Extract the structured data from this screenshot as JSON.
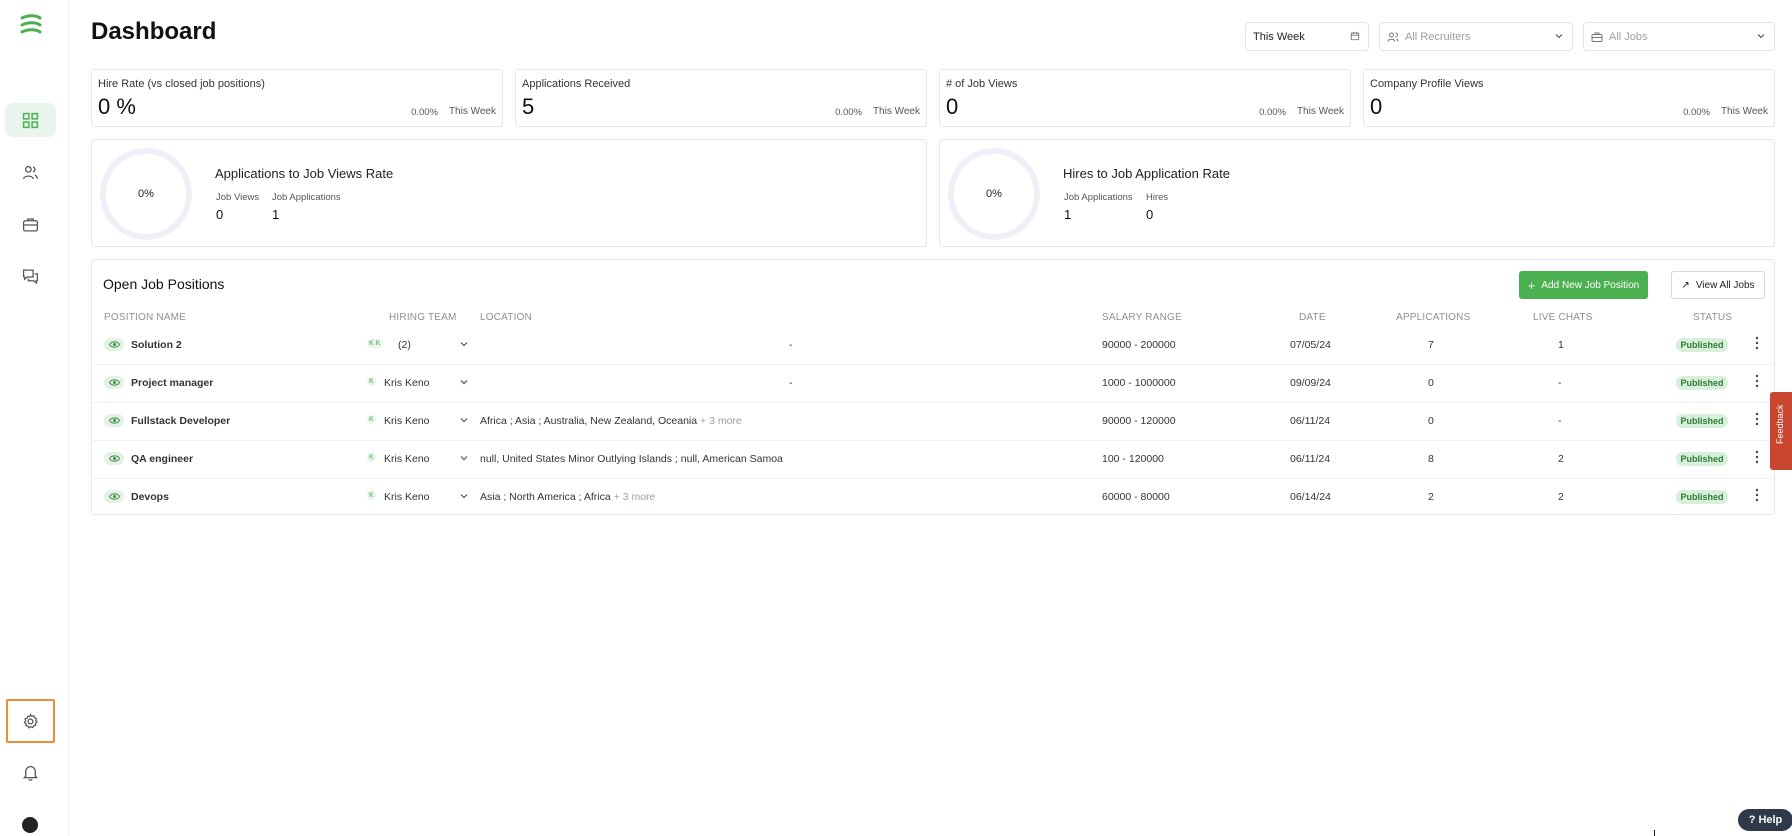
{
  "page": {
    "title": "Dashboard"
  },
  "filters": {
    "date": "This Week",
    "recruiters": "All Recruiters",
    "jobs": "All Jobs"
  },
  "kpis": [
    {
      "label": "Hire Rate (vs closed job positions)",
      "value": "0 %",
      "change": "0.00%",
      "period": "This Week"
    },
    {
      "label": "Applications Received",
      "value": "5",
      "change": "0.00%",
      "period": "This Week"
    },
    {
      "label": "# of Job Views",
      "value": "0",
      "change": "0.00%",
      "period": "This Week"
    },
    {
      "label": "Company Profile Views",
      "value": "0",
      "change": "0.00%",
      "period": "This Week"
    }
  ],
  "rates": [
    {
      "ring": "0%",
      "title": "Applications to Job Views Rate",
      "a_label": "Job Views",
      "a_value": "0",
      "b_label": "Job Applications",
      "b_value": "1"
    },
    {
      "ring": "0%",
      "title": "Hires to Job Application Rate",
      "a_label": "Job Applications",
      "a_value": "1",
      "b_label": "Hires",
      "b_value": "0"
    }
  ],
  "jobs": {
    "title": "Open Job Positions",
    "add_button": "Add New Job Position",
    "view_all_button": "View All Jobs",
    "headers": [
      "POSITION NAME",
      "HIRING TEAM",
      "LOCATION",
      "SALARY RANGE",
      "DATE",
      "APPLICATIONS",
      "LIVE CHATS",
      "STATUS"
    ],
    "rows": [
      {
        "name": "Solution 2",
        "team_avatar": "K K",
        "team": "(2)",
        "location": "",
        "location_dash": "-",
        "more": "",
        "salary": "90000 - 200000",
        "date": "07/05/24",
        "applications": "7",
        "chats": "1",
        "status": "Published"
      },
      {
        "name": "Project manager",
        "team_avatar": "K",
        "team": "Kris Keno",
        "location": "",
        "location_dash": "-",
        "more": "",
        "salary": "1000 - 1000000",
        "date": "09/09/24",
        "applications": "0",
        "chats": "-",
        "status": "Published"
      },
      {
        "name": "Fullstack Developer",
        "team_avatar": "K",
        "team": "Kris Keno",
        "location": "Africa ; Asia ; Australia, New Zealand, Oceania",
        "location_dash": "",
        "more": "+ 3 more",
        "salary": "90000 - 120000",
        "date": "06/11/24",
        "applications": "0",
        "chats": "-",
        "status": "Published"
      },
      {
        "name": "QA engineer",
        "team_avatar": "K",
        "team": "Kris Keno",
        "location": "null, United States Minor Outlying Islands ; null, American Samoa",
        "location_dash": "",
        "more": "",
        "salary": "100 - 120000",
        "date": "06/11/24",
        "applications": "8",
        "chats": "2",
        "status": "Published"
      },
      {
        "name": "Devops",
        "team_avatar": "K",
        "team": "Kris Keno",
        "location": "Asia ; North America ; Africa",
        "location_dash": "",
        "more": "+ 3 more",
        "salary": "60000 - 80000",
        "date": "06/14/24",
        "applications": "2",
        "chats": "2",
        "status": "Published"
      }
    ]
  },
  "widgets": {
    "feedback": "Feedback",
    "help": "Help"
  },
  "sidebar": {
    "icons": [
      "dashboard-grid-icon",
      "candidates-people-icon",
      "jobs-briefcase-icon",
      "messages-chat-icon",
      "settings-gear-icon",
      "notifications-bell-icon",
      "profile-avatar-icon"
    ]
  },
  "colors": {
    "accent": "#4caf50",
    "status_bg": "#d8efdb",
    "settings_highlight": "#f08b3a",
    "feedback": "#c8452f"
  }
}
